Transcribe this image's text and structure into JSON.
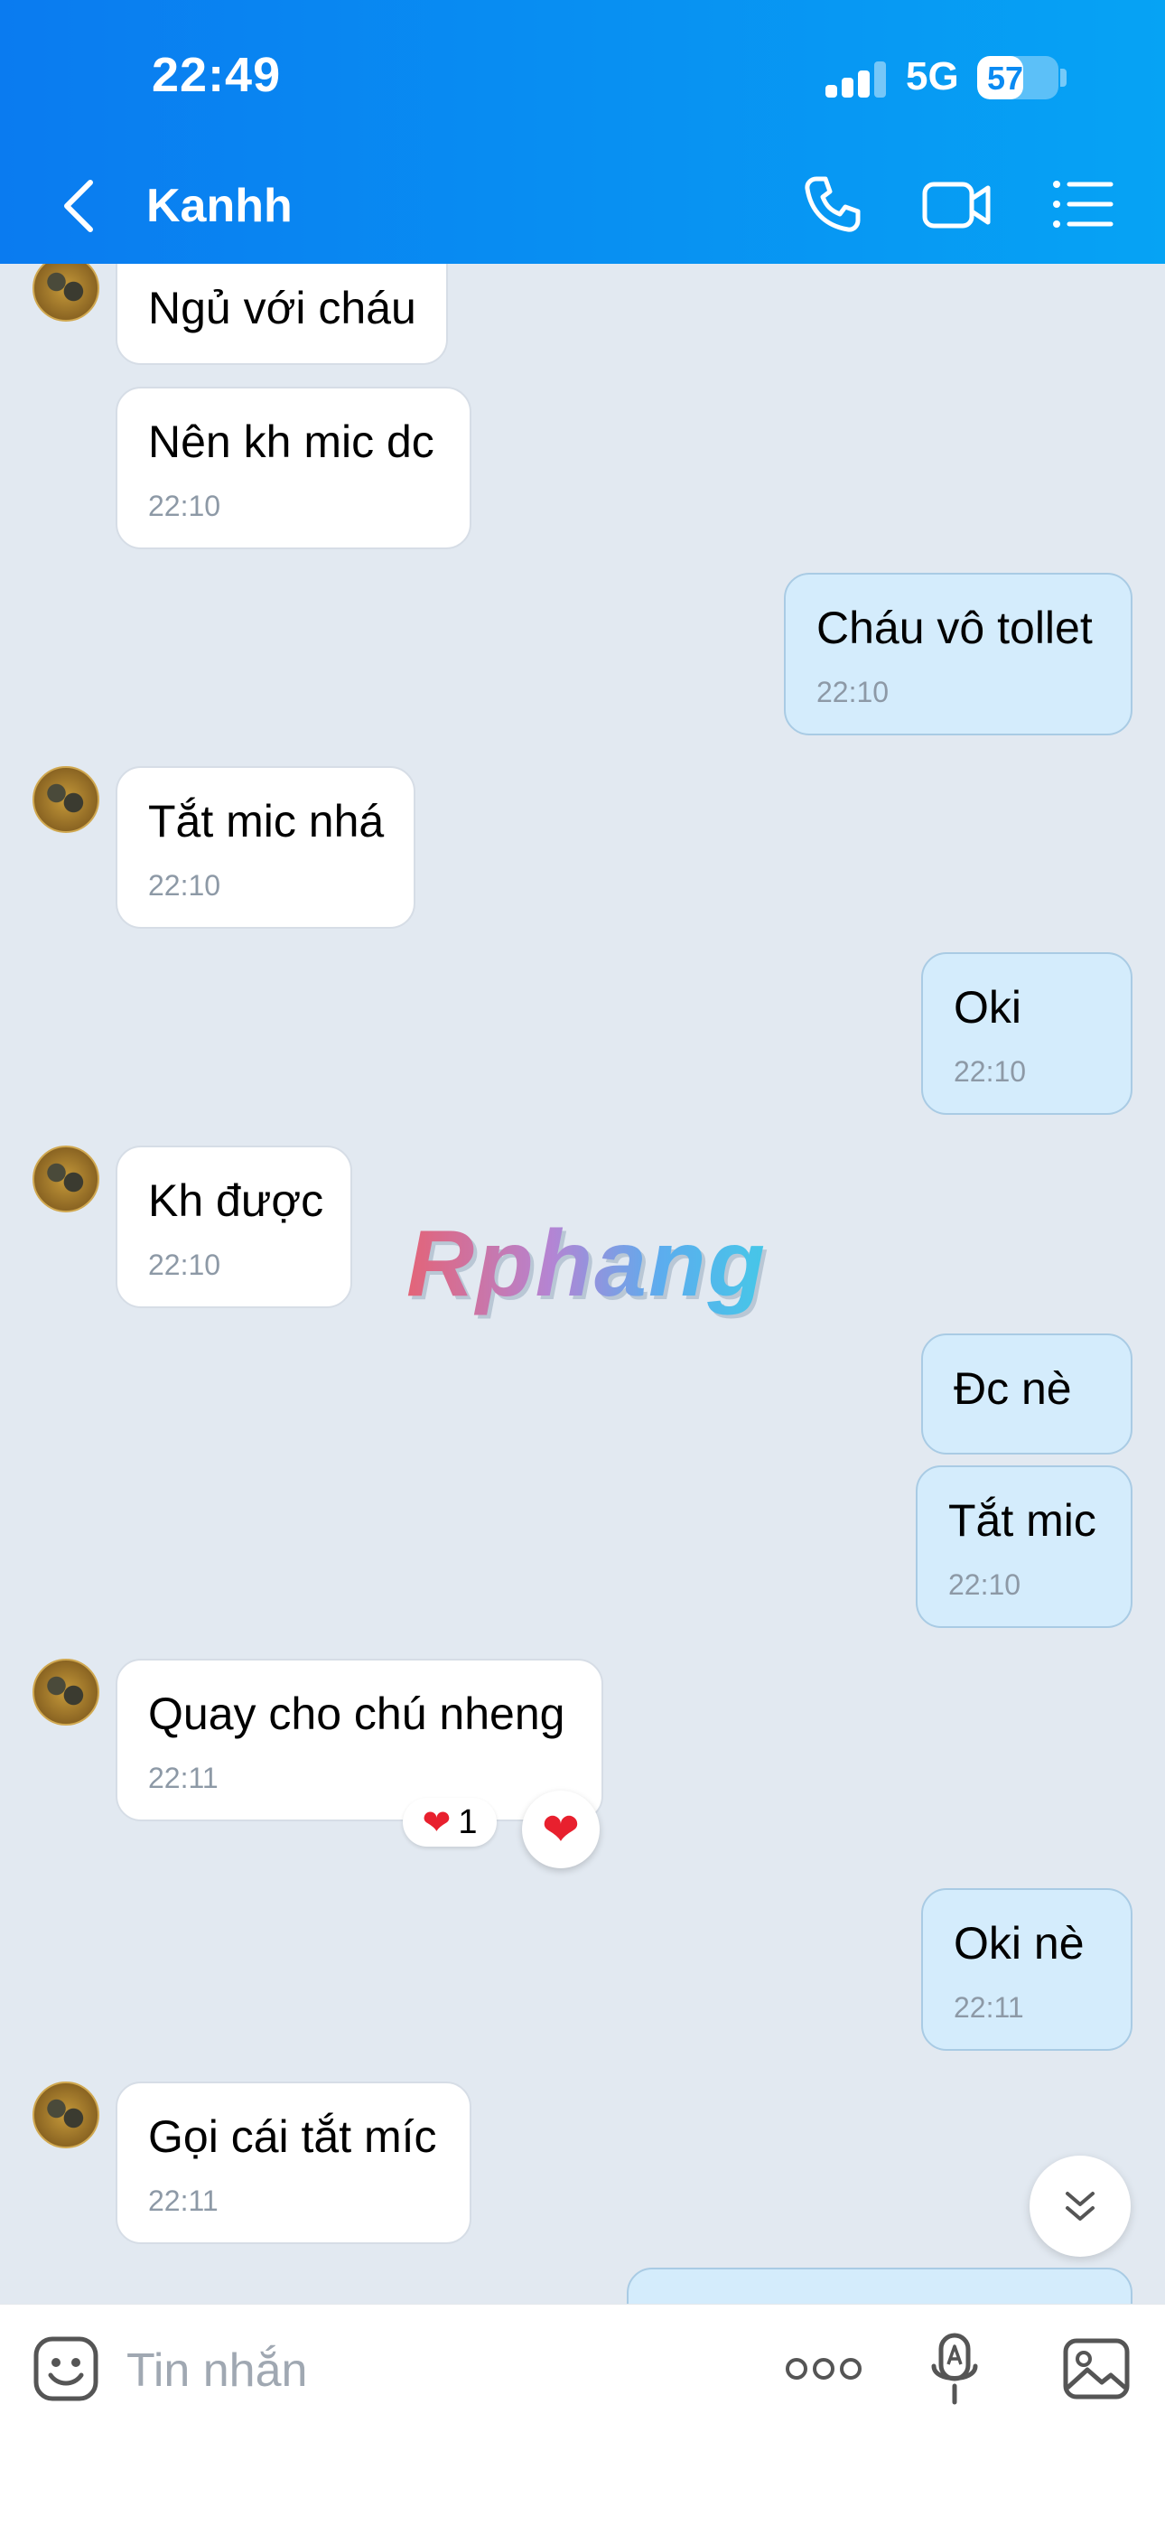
{
  "status_bar": {
    "time": "22:49",
    "network": "5G",
    "battery": "57",
    "battery_level": 0.57,
    "signal_bars": 3,
    "signal_max": 4
  },
  "header": {
    "contact_name": "Kanhh"
  },
  "messages": [
    {
      "text": "Ngủ với cháu",
      "time": ""
    },
    {
      "text": "Nên kh mic dc",
      "time": "22:10"
    },
    {
      "text": "Cháu vô tollet",
      "time": "22:10"
    },
    {
      "text": "Tắt mic nhá",
      "time": "22:10"
    },
    {
      "text": "Oki",
      "time": "22:10"
    },
    {
      "text": "Kh được",
      "time": "22:10"
    },
    {
      "text": "Đc nè",
      "time": ""
    },
    {
      "text": "Tắt mic",
      "time": "22:10"
    },
    {
      "text": "Quay cho chú nheng",
      "time": "22:11"
    },
    {
      "text": "Oki nè",
      "time": "22:11"
    },
    {
      "text": "Gọi cái tắt míc",
      "time": "22:11"
    }
  ],
  "reactions": {
    "count": "1"
  },
  "watermark": "Rphang",
  "composer": {
    "placeholder": "Tin nhắn"
  },
  "colors": {
    "header_start": "#0a7bf0",
    "header_end": "#06a3f4",
    "outgoing_bubble": "#d4ecfc",
    "incoming_bubble": "#ffffff",
    "chat_bg": "#e2e9f1",
    "heart": "#e8202e"
  }
}
